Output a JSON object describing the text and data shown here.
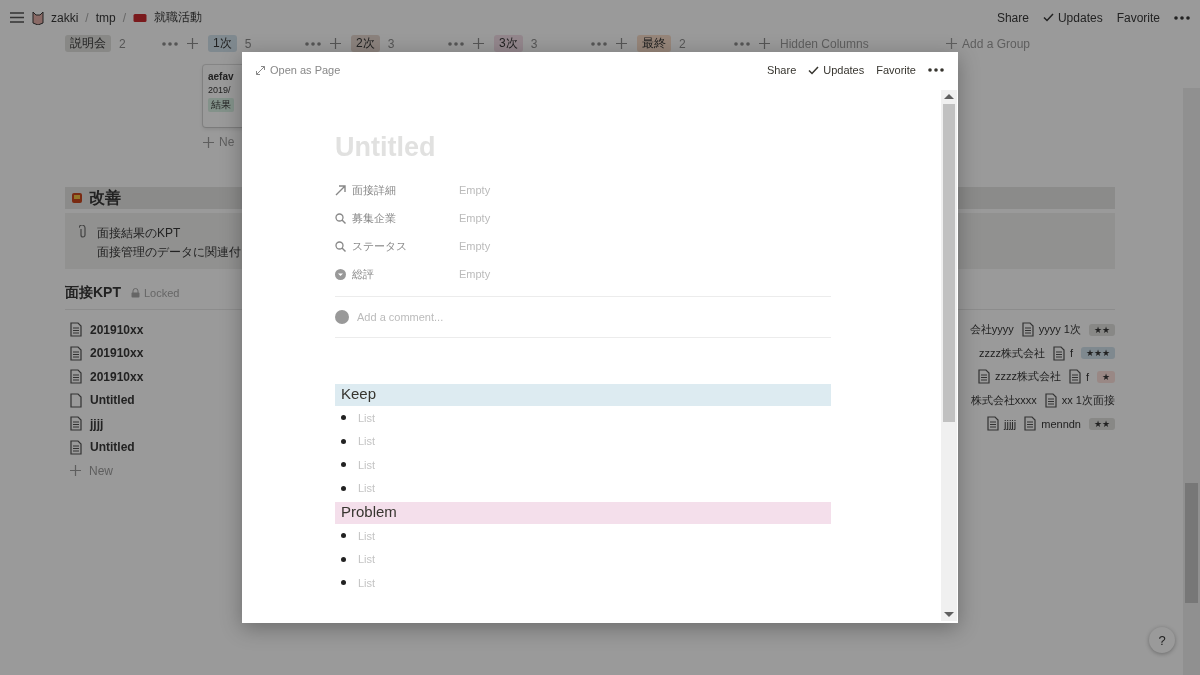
{
  "topbar": {
    "separator": "/",
    "breadcrumb": [
      {
        "text": "zakki"
      },
      {
        "text": "tmp"
      },
      {
        "text": "就職活動"
      }
    ],
    "actions": [
      {
        "label": "Share",
        "kind": "plain"
      },
      {
        "label": "Updates",
        "kind": "check"
      },
      {
        "label": "Favorite",
        "kind": "plain"
      }
    ]
  },
  "board": {
    "groups": [
      {
        "label": "説明会",
        "count": "2",
        "color": "#888886"
      },
      {
        "label": "1次",
        "count": "5",
        "color": "#7f898f"
      },
      {
        "label": "2次",
        "count": "3",
        "color": "#8b827d"
      },
      {
        "label": "3次",
        "count": "3",
        "color": "#93868c"
      },
      {
        "label": "最終",
        "count": "2",
        "color": "#968579"
      }
    ],
    "hidden_columns": "Hidden Columns",
    "add_group": "Add a Group",
    "card": {
      "title": "aefav",
      "date": "2019/",
      "tag": "結果"
    },
    "new": "Ne"
  },
  "section": {
    "title": "改善"
  },
  "callout": {
    "title": "面接結果のKPT",
    "text": "面接管理のデータに関連付"
  },
  "database": {
    "title": "面接KPT",
    "locked": "Locked",
    "new": "New",
    "rows": [
      {
        "name": "201910xx",
        "has_content": true,
        "cells": [
          {
            "text": "会社yyyy",
            "kind": "text"
          },
          {
            "text": "yyyy 1次",
            "kind": "page"
          }
        ],
        "tag": {
          "text": "★★",
          "color": "#888886"
        }
      },
      {
        "name": "201910xx",
        "has_content": true,
        "cells": [
          {
            "text": "zzzz株式会社",
            "kind": "text"
          },
          {
            "text": "f",
            "kind": "page"
          }
        ],
        "tag": {
          "text": "★★★",
          "color": "#7f898f"
        }
      },
      {
        "name": "201910xx",
        "has_content": true,
        "cells": [
          {
            "text": "zzzz株式会社",
            "kind": "page"
          },
          {
            "text": "f",
            "kind": "page"
          }
        ],
        "tag": {
          "text": "★",
          "color": "#998885"
        }
      },
      {
        "name": "Untitled",
        "has_content": false,
        "cells": [
          {
            "text": "株式会社xxxx",
            "kind": "text"
          },
          {
            "text": "xx 1次面接",
            "kind": "page"
          }
        ]
      },
      {
        "name": "jjjj",
        "has_content": true,
        "cells": [
          {
            "text": "jjjjj",
            "kind": "page"
          },
          {
            "text": "menndn",
            "kind": "page"
          }
        ],
        "tag": {
          "text": "★★",
          "color": "#888886"
        }
      },
      {
        "name": "Untitled",
        "has_content": true,
        "cells": []
      }
    ]
  },
  "help": "?",
  "modal": {
    "open_as_page": "Open as Page",
    "actions": [
      {
        "label": "Share",
        "kind": "plain"
      },
      {
        "label": "Updates",
        "kind": "check"
      },
      {
        "label": "Favorite",
        "kind": "plain"
      }
    ],
    "title_placeholder": "Untitled",
    "properties": [
      {
        "name": "面接詳細",
        "kind": "relation",
        "value": "Empty"
      },
      {
        "name": "募集企業",
        "kind": "rollup",
        "value": "Empty"
      },
      {
        "name": "ステータス",
        "kind": "rollup",
        "value": "Empty"
      },
      {
        "name": "総評",
        "kind": "select",
        "value": "Empty"
      }
    ],
    "comment_placeholder": "Add a comment...",
    "blocks": [
      {
        "kind": "heading",
        "text": "Keep",
        "color": "#ddebf1"
      },
      {
        "kind": "bullet",
        "placeholder": "List"
      },
      {
        "kind": "bullet",
        "placeholder": "List"
      },
      {
        "kind": "bullet",
        "placeholder": "List"
      },
      {
        "kind": "bullet",
        "placeholder": "List"
      },
      {
        "kind": "heading",
        "text": "Problem",
        "color": "#f4dfeb"
      },
      {
        "kind": "bullet",
        "placeholder": "List"
      },
      {
        "kind": "bullet",
        "placeholder": "List"
      },
      {
        "kind": "bullet",
        "placeholder": "List"
      }
    ]
  }
}
